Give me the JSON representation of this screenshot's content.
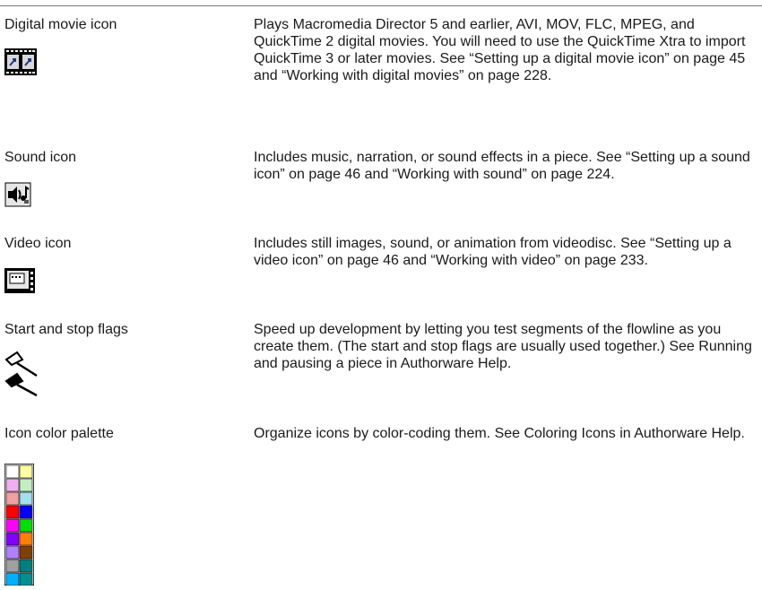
{
  "entries": [
    {
      "term": "Digital movie icon",
      "icon": "digital-movie-icon",
      "description": "Plays Macromedia Director 5 and earlier, AVI, MOV, FLC, MPEG, and QuickTime 2 digital movies. You will need to use the QuickTime Xtra to import QuickTime 3 or later movies. See “Setting up a digital movie icon” on page 45 and “Working with digital movies” on page 228."
    },
    {
      "term": "Sound icon",
      "icon": "sound-icon",
      "description": "Includes music, narration, or sound effects in a piece. See “Setting up a sound icon” on page 46 and “Working with sound” on page 224."
    },
    {
      "term": "Video icon",
      "icon": "video-icon",
      "description": "Includes still images, sound, or animation from videodisc. See “Setting up a video icon” on page 46 and “Working with video” on page 233."
    },
    {
      "term": "Start and stop flags",
      "icon": "start-stop-flags-icon",
      "description": "Speed up development by letting you test segments of the flowline as you create them. (The start and stop flags are usually used together.) See Running and pausing a piece in Authorware Help."
    },
    {
      "term": "Icon color palette",
      "icon": "color-palette-icon",
      "description": "Organize icons by color-coding them. See  Coloring Icons in Authorware Help."
    }
  ],
  "palette_colors": [
    [
      "#ffffff",
      "#ffffa0"
    ],
    [
      "#f0b0f0",
      "#c0f0c0"
    ],
    [
      "#f0a0a0",
      "#a0e0f0"
    ],
    [
      "#ff0000",
      "#0000ff"
    ],
    [
      "#ff00ff",
      "#00e000"
    ],
    [
      "#8000ff",
      "#ff8000"
    ],
    [
      "#b080ff",
      "#804000"
    ],
    [
      "#a0a0a0",
      "#008080"
    ],
    [
      "#00b0ff",
      "#009090"
    ]
  ]
}
